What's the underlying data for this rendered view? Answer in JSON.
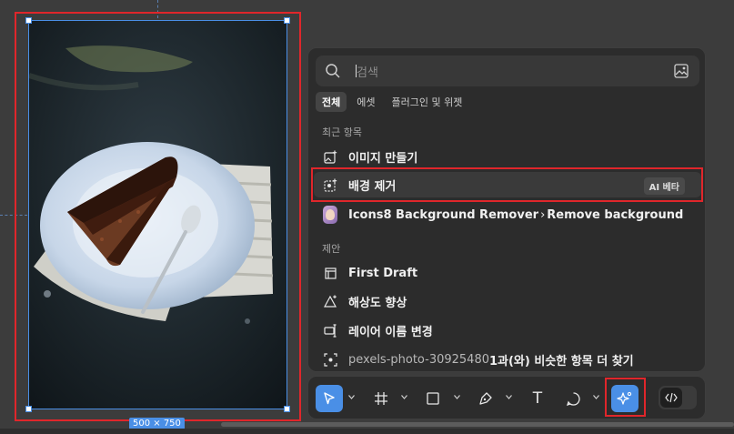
{
  "canvas": {
    "frame_size_label": "500 × 750"
  },
  "search": {
    "placeholder": "검색"
  },
  "tabs": [
    {
      "label": "전체",
      "active": true
    },
    {
      "label": "에셋",
      "active": false
    },
    {
      "label": "플러그인 및 위젯",
      "active": false
    }
  ],
  "recent": {
    "heading": "최근 항목",
    "items": [
      {
        "label": "이미지 만들기",
        "icon": "image-plus-icon"
      },
      {
        "label": "배경 제거",
        "icon": "remove-background-icon",
        "badge": "AI 베타"
      },
      {
        "label": "Icons8 Background Remover",
        "suffix": "Remove background",
        "icon": "plugin-avatar-icon"
      }
    ]
  },
  "suggestions": {
    "heading": "제안",
    "items": [
      {
        "label": "First Draft",
        "icon": "first-draft-icon"
      },
      {
        "label": "해상도 향상",
        "icon": "upscale-icon"
      },
      {
        "label": "레이어 이름 변경",
        "icon": "rename-layers-icon"
      },
      {
        "label_prefix": "pexels-photo-30925480",
        "label_suffix": " 1과(와) 비슷한 항목 더 찾기",
        "icon": "find-similar-icon"
      }
    ]
  },
  "toolbar": {
    "tools": [
      "move-tool",
      "frame-tool",
      "shape-tool",
      "pen-tool",
      "text-tool",
      "comment-tool",
      "ai-tool",
      "dev-mode-toggle"
    ],
    "text_tool_glyph": "T"
  },
  "colors": {
    "accent": "#4a8fe6",
    "highlight_red": "#e0262b",
    "panel_bg": "#2c2c2c"
  }
}
